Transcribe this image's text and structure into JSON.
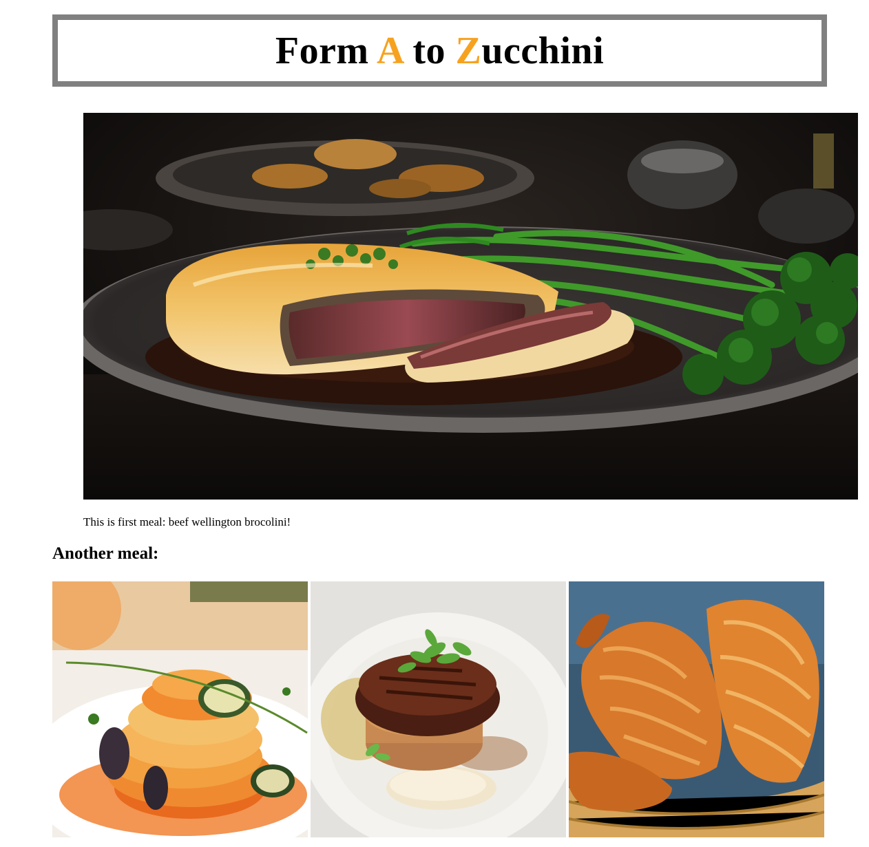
{
  "header": {
    "title_part1": "Form ",
    "title_a": "A",
    "title_part2": " to ",
    "title_z": "Z",
    "title_part3": "ucchini",
    "accent_color": "#f6a21f",
    "border_color": "#808080"
  },
  "hero": {
    "image_subject": "beef-wellington-with-broccolini",
    "caption": "This is first meal: beef wellington brocolini!"
  },
  "gallery": {
    "heading": "Another meal:",
    "images": [
      {
        "subject": "vegetable-ratatouille"
      },
      {
        "subject": "seared-steak-on-plate"
      },
      {
        "subject": "croissants-in-basket"
      }
    ]
  }
}
